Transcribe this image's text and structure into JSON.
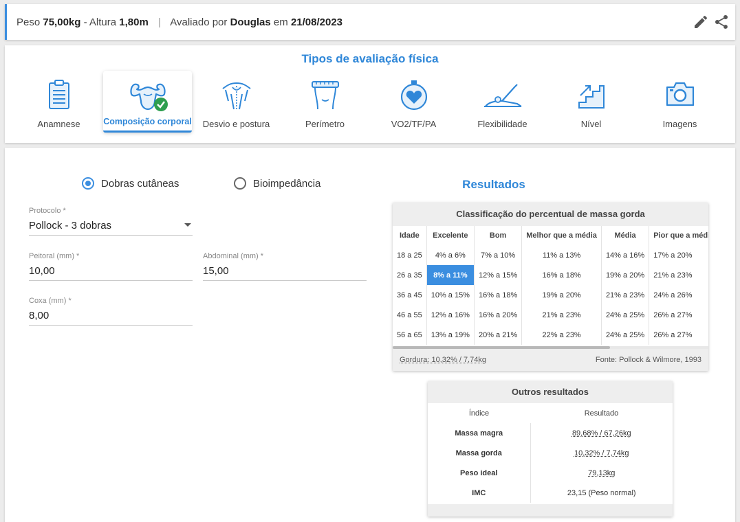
{
  "header": {
    "weight_label": "Peso",
    "weight_value": "75,00kg",
    "height_label": "- Altura",
    "height_value": "1,80m",
    "separator": "|",
    "evaluated_by_label": "Avaliado por",
    "evaluator": "Douglas",
    "date_label": "em",
    "date": "21/08/2023",
    "edit_icon": "pencil-icon",
    "share_icon": "share-icon"
  },
  "types": {
    "title": "Tipos de avaliação física",
    "items": [
      {
        "label": "Anamnese",
        "icon": "clipboard-icon"
      },
      {
        "label": "Composição corporal",
        "icon": "muscle-body-icon",
        "active": true
      },
      {
        "label": "Desvio e postura",
        "icon": "posture-back-icon"
      },
      {
        "label": "Perímetro",
        "icon": "measuring-tape-icon"
      },
      {
        "label": "VO2/TF/PA",
        "icon": "heart-stopwatch-icon"
      },
      {
        "label": "Flexibilidade",
        "icon": "stretching-icon"
      },
      {
        "label": "Nível",
        "icon": "stairs-icon"
      },
      {
        "label": "Imagens",
        "icon": "camera-icon"
      }
    ]
  },
  "method": {
    "options": [
      {
        "label": "Dobras cutâneas",
        "selected": true
      },
      {
        "label": "Bioimpedância",
        "selected": false
      }
    ]
  },
  "form": {
    "protocol": {
      "label": "Protocolo *",
      "value": "Pollock - 3 dobras"
    },
    "peitoral": {
      "label": "Peitoral (mm) *",
      "value": "10,00"
    },
    "abdominal": {
      "label": "Abdominal (mm) *",
      "value": "15,00"
    },
    "coxa": {
      "label": "Coxa (mm) *",
      "value": "8,00"
    }
  },
  "results": {
    "title": "Resultados",
    "classification": {
      "title": "Classificação do percentual de massa gorda",
      "headers": [
        "Idade",
        "Excelente",
        "Bom",
        "Melhor que a média",
        "Média",
        "Pior que a média"
      ],
      "rows": [
        [
          "18 a 25",
          "4% a 6%",
          "7% a 10%",
          "11% a 13%",
          "14% a 16%",
          "17% a 20%"
        ],
        [
          "26 a 35",
          "8% a 11%",
          "12% a 15%",
          "16% a 18%",
          "19% a 20%",
          "21% a 23%"
        ],
        [
          "36 a 45",
          "10% a 15%",
          "16% a 18%",
          "19% a 20%",
          "21% a 23%",
          "24% a 26%"
        ],
        [
          "46 a 55",
          "12% a 16%",
          "16% a 20%",
          "21% a 23%",
          "24% a 25%",
          "26% a 27%"
        ],
        [
          "56 a 65",
          "13% a 19%",
          "20% a 21%",
          "22% a 23%",
          "24% a 25%",
          "26% a 27%"
        ]
      ],
      "highlight": {
        "row": 1,
        "col": 1
      },
      "footer_left": "Gordura: 10,32% / 7,74kg",
      "footer_right": "Fonte: Pollock & Wilmore, 1993"
    },
    "other": {
      "title": "Outros resultados",
      "headers": [
        "Índice",
        "Resultado"
      ],
      "rows": [
        {
          "index": "Massa magra",
          "result": "89,68% / 67,26kg"
        },
        {
          "index": "Massa gorda",
          "result": "10,32% / 7,74kg"
        },
        {
          "index": "Peso ideal",
          "result": "79,13kg"
        },
        {
          "index": "IMC",
          "result": "23,15 (Peso normal)"
        }
      ]
    }
  },
  "colors": {
    "accent": "#2f87d8",
    "highlight": "#3b8ee0",
    "success": "#2e9e4f"
  }
}
